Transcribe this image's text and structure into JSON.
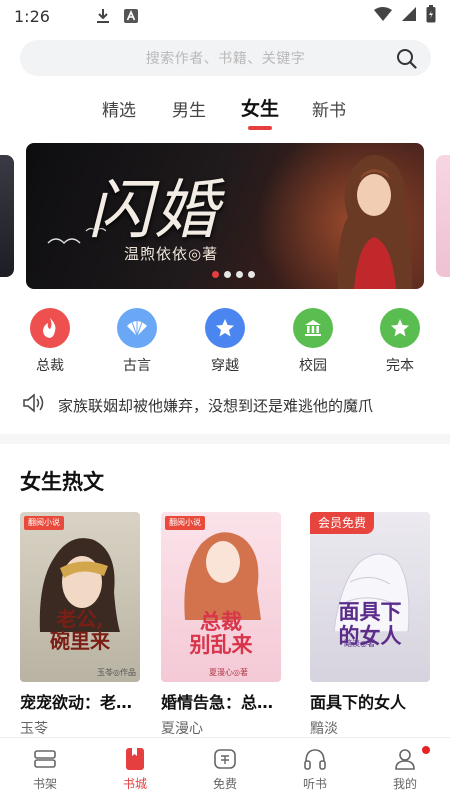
{
  "status_bar": {
    "time": "1:26",
    "icons": [
      "download-icon",
      "a-app-icon",
      "wifi-icon",
      "signal-icon",
      "battery-icon"
    ]
  },
  "search": {
    "placeholder": "搜索作者、书籍、关键字"
  },
  "tabs": [
    {
      "label": "精选",
      "active": false
    },
    {
      "label": "男生",
      "active": false
    },
    {
      "label": "女生",
      "active": true
    },
    {
      "label": "新书",
      "active": false
    }
  ],
  "banner": {
    "title": "闪婚",
    "author_line": "温煦依依◎著",
    "slide_count": 4,
    "active_slide": 0
  },
  "categories": [
    {
      "label": "总裁",
      "icon": "fire-icon",
      "color": "#ee4f4f"
    },
    {
      "label": "古言",
      "icon": "fan-icon",
      "color": "#6aa8f5"
    },
    {
      "label": "穿越",
      "icon": "star-icon",
      "color": "#4b86f0"
    },
    {
      "label": "校园",
      "icon": "school-icon",
      "color": "#59bd4f"
    },
    {
      "label": "完本",
      "icon": "star-icon",
      "color": "#59bd4f"
    }
  ],
  "notice": {
    "icon": "speaker-icon",
    "text": "家族联姻却被他嫌弃，没想到还是难逃他的魔爪"
  },
  "hot_section": {
    "title": "女生热文",
    "books": [
      {
        "title": "宠宠欲动：老…",
        "author": "玉苓",
        "cover_title": "老公,\n碗里来",
        "cover_badge": "翻阅小说",
        "cover_author": "玉苓◎作品"
      },
      {
        "title": "婚情告急：总…",
        "author": "夏漫心",
        "cover_title": "总裁\n别乱来",
        "cover_badge": "翻阅小说",
        "cover_author": "夏漫心◎著"
      },
      {
        "title": "面具下的女人",
        "author": "黯淡",
        "cover_title": "面具下\n的女人",
        "cover_badge": "会员免费",
        "cover_author": "黯淡◎著"
      }
    ]
  },
  "bottom_nav": [
    {
      "label": "书架",
      "icon": "bookshelf-icon",
      "active": false
    },
    {
      "label": "书城",
      "icon": "bookstore-icon",
      "active": true
    },
    {
      "label": "免费",
      "icon": "free-icon",
      "active": false
    },
    {
      "label": "听书",
      "icon": "headphones-icon",
      "active": false
    },
    {
      "label": "我的",
      "icon": "profile-icon",
      "active": false,
      "has_notification": true
    }
  ],
  "colors": {
    "accent": "#e63f3f",
    "text": "#222222",
    "muted": "#666666"
  }
}
